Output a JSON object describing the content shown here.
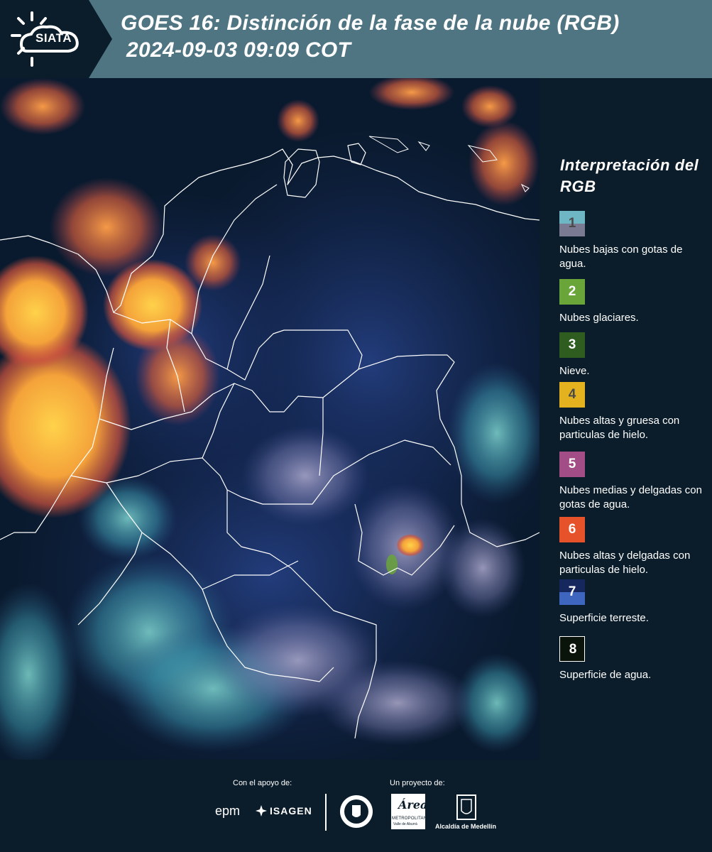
{
  "header": {
    "logo_text": "SIATA",
    "title_line1": "GOES 16: Distinción de la fase de la nube (RGB)",
    "title_line2": "2024-09-03 09:09 COT"
  },
  "legend": {
    "title": "Interpretación del RGB",
    "items": [
      {
        "num": "1",
        "label": "Nubes bajas con gotas de agua.",
        "color_top": "#6fb6c4",
        "color_bottom": "#7a7a93"
      },
      {
        "num": "2",
        "label": "Nubes glaciares.",
        "color_top": "#6aa53a",
        "color_bottom": "#6aa53a"
      },
      {
        "num": "3",
        "label": "Nieve.",
        "color_top": "#2f5c1f",
        "color_bottom": "#2f5c1f"
      },
      {
        "num": "4",
        "label": "Nubes altas y gruesa con particulas de hielo.",
        "color_top": "#e3b21e",
        "color_bottom": "#e3b21e"
      },
      {
        "num": "5",
        "label": "Nubes medias y delgadas con gotas de agua.",
        "color_top": "#a24d86",
        "color_bottom": "#a24d86"
      },
      {
        "num": "6",
        "label": "Nubes altas y delgadas con particulas de hielo.",
        "color_top": "#e6522a",
        "color_bottom": "#e6522a"
      },
      {
        "num": "7",
        "label": "Superficie terreste.",
        "color_top": "#16275e",
        "color_bottom": "#3e66bf"
      },
      {
        "num": "8",
        "label": "Superficie de agua.",
        "color_top": "#0a140a",
        "color_bottom": "#0a140a"
      }
    ]
  },
  "footer": {
    "support_label": "Con el apoyo de:",
    "project_label": "Un proyecto de:",
    "sponsors": [
      "epm",
      "ISAGEN"
    ],
    "partners": [
      "METROPOLITANA",
      "Alcaldía de Medellín"
    ],
    "area_script": "Área",
    "area_sub": "Valle de Aburrá"
  },
  "colors": {
    "header_band": "#4f7482",
    "background": "#0b1d2a",
    "map_ocean": "#0a1a2e"
  }
}
